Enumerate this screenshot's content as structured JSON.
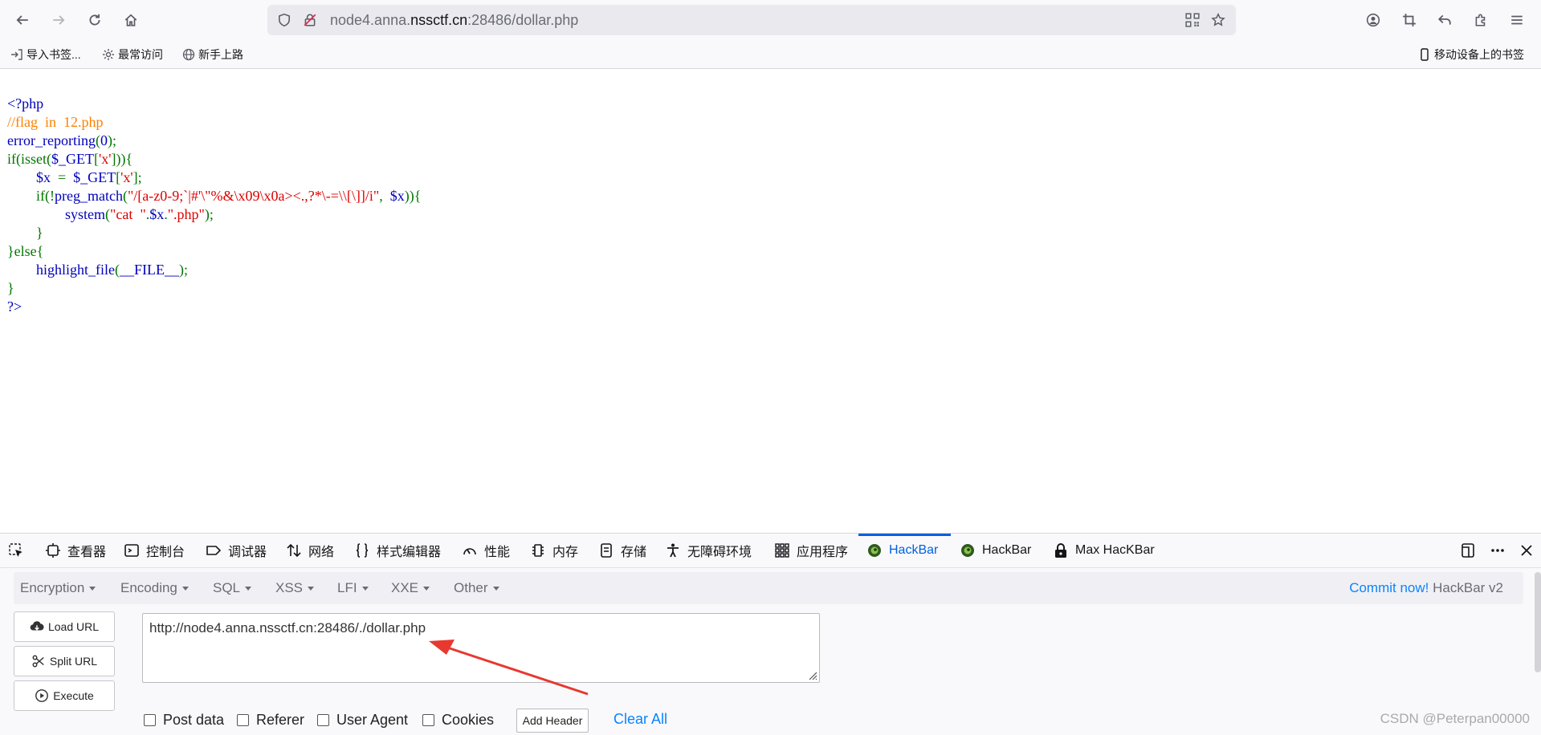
{
  "browser": {
    "url_host_pre": "node4.anna.",
    "url_host_main": "nssctf.cn",
    "url_rest": ":28486/dollar.php",
    "bookmarks": [
      "导入书签...",
      "最常访问",
      "新手上路"
    ],
    "mobile_bookmarks": "移动设备上的书签"
  },
  "code": {
    "l1": "<?php",
    "l2": "//flag  in  12.php",
    "l3_fn": "error_reporting",
    "l3_a": "(",
    "l3_b": "0",
    "l3_c": ");",
    "l4_a": "if(isset(",
    "l4_b": "$_GET",
    "l4_c": "[",
    "l4_d": "'x'",
    "l4_e": "])){",
    "l5_indent": "        ",
    "l5_a": "$x  ",
    "l5_b": "=  ",
    "l5_c": "$_GET",
    "l5_d": "[",
    "l5_e": "'x'",
    "l5_f": "];",
    "l6_indent": "        ",
    "l6_a": "if(!",
    "l6_b": "preg_match",
    "l6_c": "(",
    "l6_d": "\"/[a-z0-9;`|#'\\\"%&\\x09\\x0a><.,?*\\-=\\\\[\\]]/i\"",
    "l6_e": ",  ",
    "l6_f": "$x",
    "l6_g": ")){",
    "l7_indent": "                ",
    "l7_a": "system",
    "l7_b": "(",
    "l7_c": "\"cat  \"",
    "l7_d": ".",
    "l7_e": "$x",
    "l7_f": ".",
    "l7_g": "\".php\"",
    "l7_h": ");",
    "l8": "        }",
    "l9": "}else{",
    "l10_indent": "        ",
    "l10_a": "highlight_file",
    "l10_b": "(",
    "l10_c": "__FILE__",
    "l10_d": ");",
    "l11": "}",
    "l12": "?>"
  },
  "devtools": {
    "tabs": [
      "查看器",
      "控制台",
      "调试器",
      "网络",
      "样式编辑器",
      "性能",
      "内存",
      "存储",
      "无障碍环境",
      "应用程序",
      "HackBar",
      "HackBar",
      "Max HacKBar"
    ],
    "active_tab": "HackBar"
  },
  "hackbar": {
    "menu": [
      "Encryption",
      "Encoding",
      "SQL",
      "XSS",
      "LFI",
      "XXE",
      "Other"
    ],
    "commit_link": "Commit now!",
    "version": "HackBar v2",
    "buttons": {
      "load": "Load URL",
      "split": "Split URL",
      "execute": "Execute"
    },
    "url_value": "http://node4.anna.nssctf.cn:28486/./dollar.php",
    "checks": [
      "Post data",
      "Referer",
      "User Agent",
      "Cookies"
    ],
    "add_header": "Add Header",
    "clear_all": "Clear All"
  },
  "watermark": "CSDN @Peterpan00000",
  "colors": {
    "accent": "#0060df",
    "link": "#0a84ff",
    "php_blue": "#0000bb",
    "php_green": "#007700",
    "php_red": "#dd0000",
    "php_comment": "#ff8000",
    "annotation_arrow": "#e8382f"
  }
}
